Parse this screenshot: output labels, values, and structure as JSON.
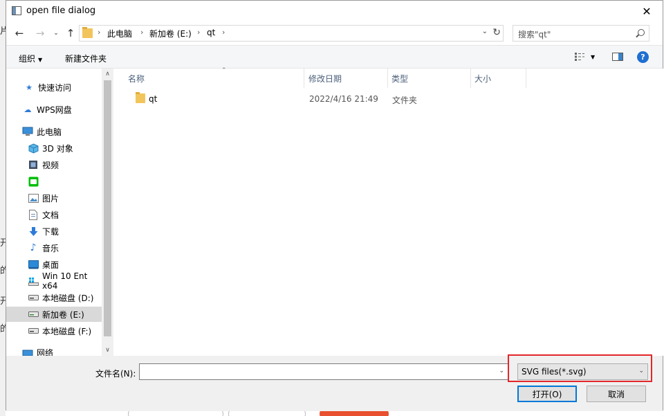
{
  "window": {
    "title": "open file dialog",
    "close": "✕"
  },
  "nav": {
    "breadcrumb": [
      "此电脑",
      "新加卷 (E:)",
      "qt"
    ],
    "search_placeholder": "搜索\"qt\""
  },
  "toolbar": {
    "organize": "组织",
    "new_folder": "新建文件夹"
  },
  "sidebar": {
    "items": [
      {
        "label": "快速访问",
        "icon": "star-icon"
      },
      {
        "label": "WPS网盘",
        "icon": "cloud-icon"
      },
      {
        "label": "此电脑",
        "icon": "computer-icon"
      },
      {
        "label": "3D 对象",
        "icon": "cube-icon"
      },
      {
        "label": "视频",
        "icon": "film-icon"
      },
      {
        "label": "",
        "icon": "iqiyi-icon"
      },
      {
        "label": "图片",
        "icon": "picture-icon"
      },
      {
        "label": "文档",
        "icon": "document-icon"
      },
      {
        "label": "下载",
        "icon": "download-icon"
      },
      {
        "label": "音乐",
        "icon": "music-icon"
      },
      {
        "label": "桌面",
        "icon": "desktop-icon"
      },
      {
        "label": "Win 10 Ent x64",
        "icon": "drive-icon"
      },
      {
        "label": "本地磁盘 (D:)",
        "icon": "drive-icon"
      },
      {
        "label": "新加卷 (E:)",
        "icon": "drive-icon",
        "selected": true
      },
      {
        "label": "本地磁盘 (F:)",
        "icon": "drive-icon"
      },
      {
        "label": "网络",
        "icon": "network-icon"
      }
    ]
  },
  "columns": {
    "name": "名称",
    "modified": "修改日期",
    "type": "类型",
    "size": "大小"
  },
  "files": [
    {
      "name": "qt",
      "modified": "2022/4/16 21:49",
      "type": "文件夹",
      "size": ""
    }
  ],
  "footer": {
    "filename_label": "文件名(N):",
    "filename_value": "",
    "filetype": "SVG files(*.svg)",
    "open_label": "打开(O)",
    "cancel_label": "取消"
  },
  "colors": {
    "accent": "#0078d7",
    "highlight_box": "#e3262a",
    "folder": "#f2c55c"
  }
}
